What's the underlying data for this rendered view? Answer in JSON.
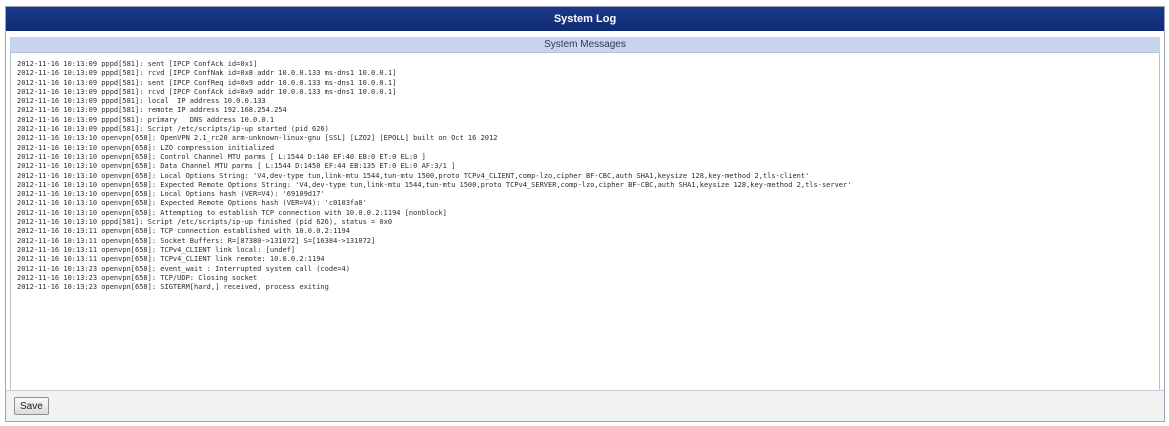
{
  "window": {
    "title": "System Log"
  },
  "section": {
    "header": "System Messages"
  },
  "log_lines": [
    "2012-11-16 10:13:09 pppd[581]: sent [IPCP ConfAck id=0x1]",
    "2012-11-16 10:13:09 pppd[581]: rcvd [IPCP ConfNak id=0x8 addr 10.0.0.133 ms-dns1 10.0.0.1]",
    "2012-11-16 10:13:09 pppd[581]: sent [IPCP ConfReq id=0x9 addr 10.0.0.133 ms-dns1 10.0.0.1]",
    "2012-11-16 10:13:09 pppd[581]: rcvd [IPCP ConfAck id=0x9 addr 10.0.0.133 ms-dns1 10.0.0.1]",
    "2012-11-16 10:13:09 pppd[581]: local  IP address 10.0.0.133",
    "2012-11-16 10:13:09 pppd[581]: remote IP address 192.168.254.254",
    "2012-11-16 10:13:09 pppd[581]: primary   DNS address 10.0.0.1",
    "2012-11-16 10:13:09 pppd[581]: Script /etc/scripts/ip-up started (pid 626)",
    "2012-11-16 10:13:10 openvpn[658]: OpenVPN 2.1_rc20 arm-unknown-linux-gnu [SSL] [LZO2] [EPOLL] built on Oct 16 2012",
    "2012-11-16 10:13:10 openvpn[658]: LZO compression initialized",
    "2012-11-16 10:13:10 openvpn[658]: Control Channel MTU parms [ L:1544 D:140 EF:40 EB:0 ET:0 EL:0 ]",
    "2012-11-16 10:13:10 openvpn[658]: Data Channel MTU parms [ L:1544 D:1450 EF:44 EB:135 ET:0 EL:0 AF:3/1 ]",
    "2012-11-16 10:13:10 openvpn[658]: Local Options String: 'V4,dev-type tun,link-mtu 1544,tun-mtu 1500,proto TCPv4_CLIENT,comp-lzo,cipher BF-CBC,auth SHA1,keysize 128,key-method 2,tls-client'",
    "2012-11-16 10:13:10 openvpn[658]: Expected Remote Options String: 'V4,dev-type tun,link-mtu 1544,tun-mtu 1500,proto TCPv4_SERVER,comp-lzo,cipher BF-CBC,auth SHA1,keysize 128,key-method 2,tls-server'",
    "2012-11-16 10:13:10 openvpn[658]: Local Options hash (VER=V4): '69109d17'",
    "2012-11-16 10:13:10 openvpn[658]: Expected Remote Options hash (VER=V4): 'c0103fa8'",
    "2012-11-16 10:13:10 openvpn[658]: Attempting to establish TCP connection with 10.0.0.2:1194 [nonblock]",
    "2012-11-16 10:13:10 pppd[581]: Script /etc/scripts/ip-up finished (pid 626), status = 0x0",
    "2012-11-16 10:13:11 openvpn[658]: TCP connection established with 10.0.0.2:1194",
    "2012-11-16 10:13:11 openvpn[658]: Socket Buffers: R=[87380->131072] S=[16384->131072]",
    "2012-11-16 10:13:11 openvpn[658]: TCPv4_CLIENT link local: [undef]",
    "2012-11-16 10:13:11 openvpn[658]: TCPv4_CLIENT link remote: 10.0.0.2:1194",
    "2012-11-16 10:13:23 openvpn[658]: event_wait : Interrupted system call (code=4)",
    "2012-11-16 10:13:23 openvpn[658]: TCP/UDP: Closing socket",
    "2012-11-16 10:13:23 openvpn[658]: SIGTERM[hard,] received, process exiting"
  ],
  "footer": {
    "save_label": "Save"
  },
  "colors": {
    "title_bar": "#0f2a73",
    "section_header_bg": "#c7d4ef"
  }
}
